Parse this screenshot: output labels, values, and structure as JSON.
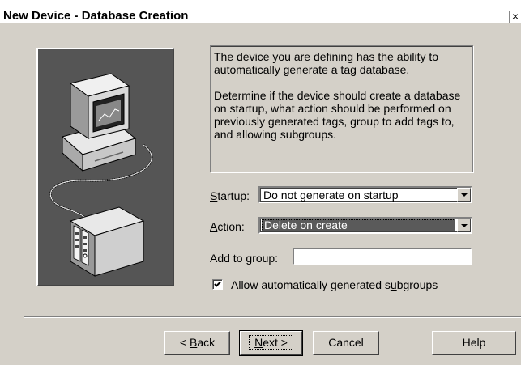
{
  "window": {
    "title": "New Device - Database Creation",
    "close_glyph": "×"
  },
  "info": {
    "paragraph1": "The device you are defining has the ability to automatically generate a tag database.",
    "paragraph2": "Determine if the device should create a database on startup, what action should be performed on previously generated tags, group to add tags to, and allowing subgroups."
  },
  "form": {
    "startup": {
      "label_prefix": "",
      "label_accel": "S",
      "label_rest": "tartup:",
      "value": "Do not generate on startup"
    },
    "action": {
      "label_prefix": "",
      "label_accel": "A",
      "label_rest": "ction:",
      "value": "Delete on create"
    },
    "add_to_group": {
      "label": "Add to group:",
      "value": ""
    },
    "subgroups": {
      "label_prefix": "Allow automatically generated s",
      "label_accel": "u",
      "label_rest": "bgroups",
      "checked": true
    }
  },
  "buttons": {
    "back": {
      "prefix": "< ",
      "accel": "B",
      "rest": "ack"
    },
    "next": {
      "prefix": "",
      "accel": "N",
      "rest": "ext >"
    },
    "cancel": "Cancel",
    "help": "Help"
  },
  "icons": {
    "illustration": "computer-connected-to-plc-device",
    "dropdown": "chevron-down-icon",
    "check": "check-icon"
  }
}
